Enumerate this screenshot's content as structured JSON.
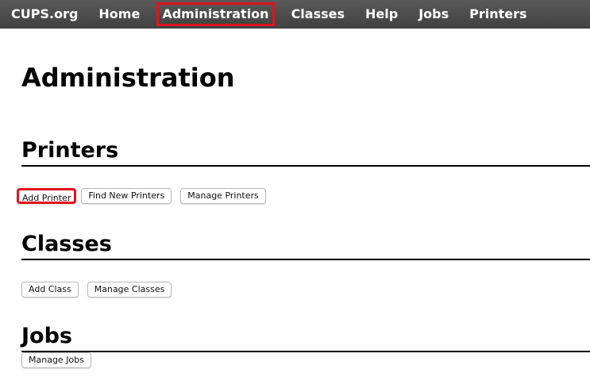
{
  "nav": {
    "items": [
      {
        "label": "CUPS.org"
      },
      {
        "label": "Home"
      },
      {
        "label": "Administration",
        "selected": true
      },
      {
        "label": "Classes"
      },
      {
        "label": "Help"
      },
      {
        "label": "Jobs"
      },
      {
        "label": "Printers"
      }
    ]
  },
  "page": {
    "title": "Administration"
  },
  "sections": {
    "printers": {
      "heading": "Printers",
      "buttons": {
        "add": "Add Printer",
        "find_new": "Find New Printers",
        "manage": "Manage Printers"
      }
    },
    "classes": {
      "heading": "Classes",
      "buttons": {
        "add": "Add Class",
        "manage": "Manage Classes"
      }
    },
    "jobs": {
      "heading": "Jobs",
      "buttons": {
        "manage": "Manage Jobs"
      }
    }
  },
  "colors": {
    "navbar": "#4a4a4a",
    "highlight": "#e0141e"
  }
}
